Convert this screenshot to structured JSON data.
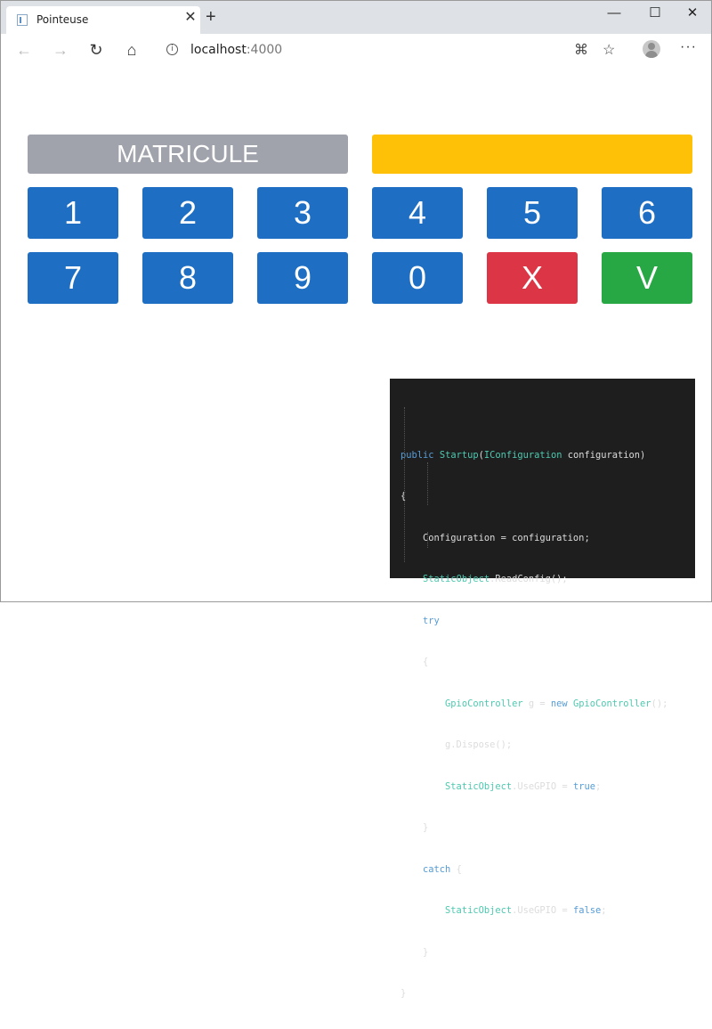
{
  "browser": {
    "tab_title": "Pointeuse",
    "tab_close": "✕",
    "new_tab": "+",
    "window_controls": {
      "minimize": "—",
      "maximize": "☐",
      "close": "✕"
    },
    "address": {
      "host": "localhost",
      "port": ":4000"
    },
    "icons": [
      "back-icon",
      "forward-icon",
      "reload-icon",
      "home-icon",
      "info-icon",
      "translate-icon",
      "favorite-icon",
      "profile-icon",
      "more-icon"
    ]
  },
  "page": {
    "matricule_label": "MATRICULE",
    "matricule_value": "",
    "keys_row1": [
      "1",
      "2",
      "3",
      "4",
      "5",
      "6"
    ],
    "keys_row2": [
      "7",
      "8",
      "9",
      "0",
      "X",
      "V"
    ]
  },
  "code": [
    "public Startup(IConfiguration configuration)",
    "{",
    "    Configuration = configuration;",
    "    StaticObject.ReadConfig();",
    "    try",
    "    {",
    "        GpioController g = new GpioController();",
    "        g.Dispose();",
    "        StaticObject.UseGPIO = true;",
    "    }",
    "    catch {",
    "        StaticObject.UseGPIO = false;",
    "    }",
    "}"
  ],
  "colors": {
    "key_blue": "#1e6fc3",
    "key_red": "#dc3545",
    "key_green": "#28a745",
    "matricule_gray": "#a0a3ab",
    "display_yellow": "#ffc107"
  }
}
